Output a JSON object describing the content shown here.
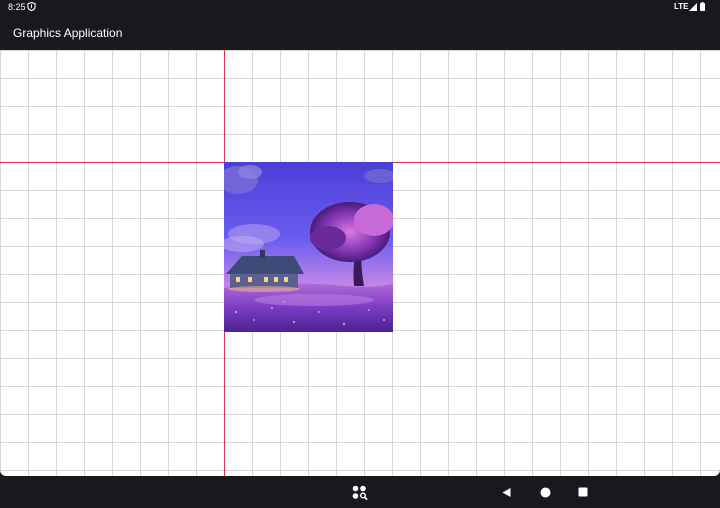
{
  "status_bar": {
    "time": "8:25",
    "network": "LTE",
    "icons": [
      "notification-shield-icon",
      "signal-icon",
      "battery-icon"
    ]
  },
  "app_bar": {
    "title": "Graphics Application"
  },
  "canvas": {
    "background": "#ffffff",
    "grid_color": "#d6d6d6",
    "axis_color": "#e0304a",
    "image": "illustration of a cottage with lit windows and a purple tree on a lavender field at dusk"
  },
  "nav_bar": {
    "icons": [
      "app-search-icon",
      "back-icon",
      "home-icon",
      "recents-icon"
    ]
  }
}
